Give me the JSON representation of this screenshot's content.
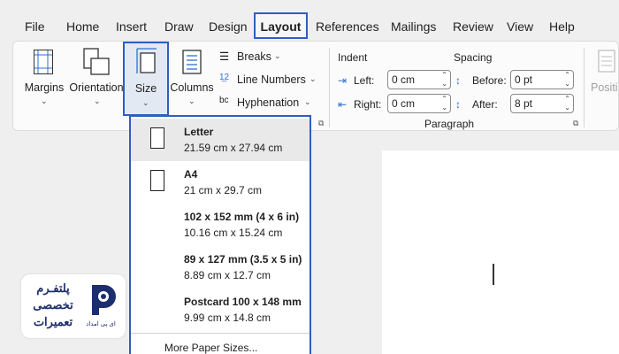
{
  "menu": {
    "items": [
      "File",
      "Home",
      "Insert",
      "Draw",
      "Design",
      "Layout",
      "References",
      "Mailings",
      "Review",
      "View",
      "Help"
    ],
    "active": "Layout"
  },
  "ribbon": {
    "margins": "Margins",
    "orientation": "Orientation",
    "size": "Size",
    "columns": "Columns",
    "breaks": "Breaks",
    "line_numbers": "Line Numbers",
    "hyphenation": "Hyphenation",
    "indent": {
      "title": "Indent",
      "left_label": "Left:",
      "left_value": "0 cm",
      "right_label": "Right:",
      "right_value": "0 cm"
    },
    "spacing": {
      "title": "Spacing",
      "before_label": "Before:",
      "before_value": "0 pt",
      "after_label": "After:",
      "after_value": "8 pt"
    },
    "paragraph_group": "Paragraph",
    "position_partial": "Positi"
  },
  "size_menu": {
    "items": [
      {
        "title": "Letter",
        "dims": "21.59 cm x 27.94 cm",
        "selected": true
      },
      {
        "title": "A4",
        "dims": "21 cm x 29.7 cm",
        "selected": false
      },
      {
        "title": "102 x 152 mm (4 x 6 in)",
        "dims": "10.16 cm x 15.24 cm",
        "selected": false
      },
      {
        "title": "89 x 127 mm (3.5 x 5 in)",
        "dims": "8.89 cm x 12.7 cm",
        "selected": false
      },
      {
        "title": "Postcard 100 x 148 mm",
        "dims": "9.99 cm x 14.8 cm",
        "selected": false
      }
    ],
    "more": "More Paper Sizes..."
  },
  "logo": {
    "line1": "پلتفـرم",
    "line2": "تخصصی",
    "line3": "تعمیرات",
    "sub": "ای پی امداد"
  },
  "colors": {
    "accent": "#2f5fbd",
    "logo": "#1c2e6e"
  }
}
